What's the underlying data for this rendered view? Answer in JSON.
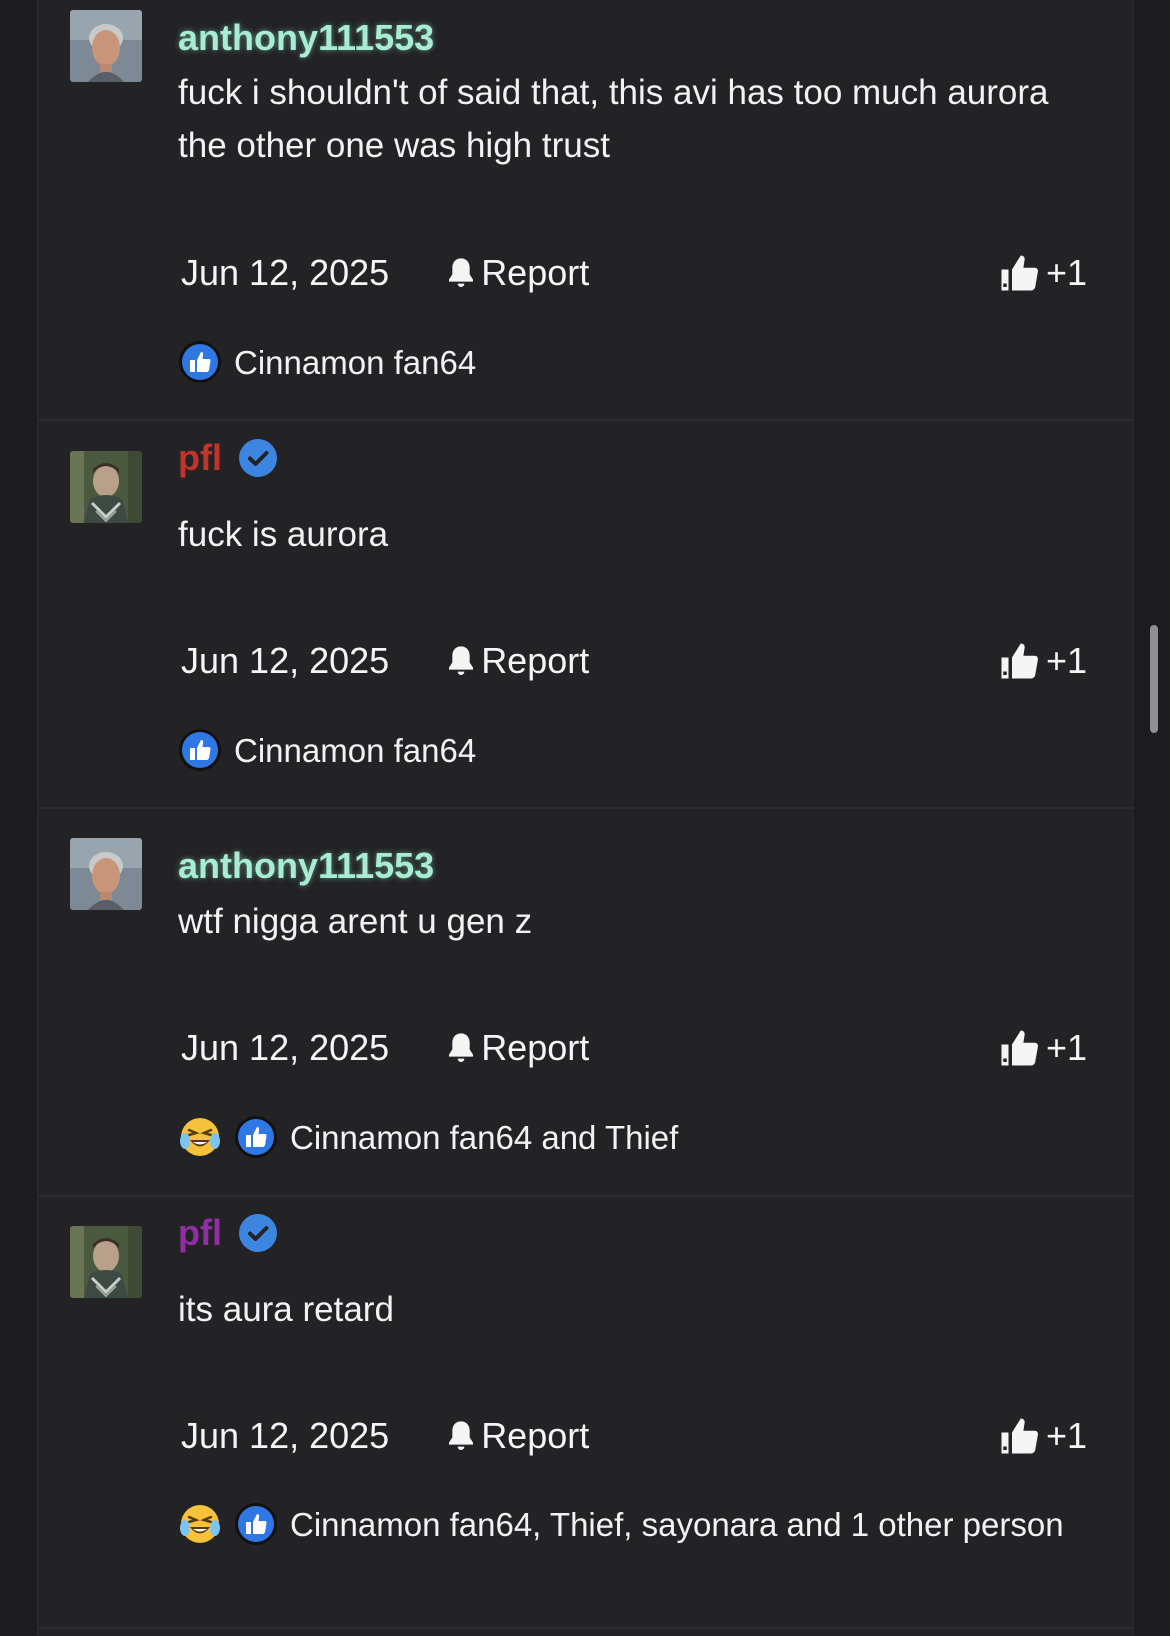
{
  "posts": [
    {
      "username": "anthony111553",
      "name_color": "#a8ecd4",
      "verified": false,
      "message": "fuck i shouldn't of said that, this avi has too much aurora the other one was high trust",
      "date": "Jun 12, 2025",
      "report_label": "Report",
      "like_count": "+1",
      "reactors": "Cinnamon fan64",
      "reaction_icons": [
        "thumbs-up"
      ]
    },
    {
      "username": "pfl",
      "name_color": "#c0342b",
      "verified": true,
      "message": "fuck is aurora",
      "date": "Jun 12, 2025",
      "report_label": "Report",
      "like_count": "+1",
      "reactors": "Cinnamon fan64",
      "reaction_icons": [
        "thumbs-up"
      ]
    },
    {
      "username": "anthony111553",
      "name_color": "#a8ecd4",
      "verified": false,
      "message": "wtf nigga arent u gen z",
      "date": "Jun 12, 2025",
      "report_label": "Report",
      "like_count": "+1",
      "reactors": "Cinnamon fan64 and Thief",
      "reaction_icons": [
        "laughing-crying",
        "thumbs-up"
      ]
    },
    {
      "username": "pfl",
      "name_color": "#8e2fa3",
      "verified": true,
      "message": "its aura retard",
      "date": "Jun 12, 2025",
      "report_label": "Report",
      "like_count": "+1",
      "reactors": "Cinnamon fan64, Thief, sayonara and 1 other person",
      "reaction_icons": [
        "laughing-crying",
        "thumbs-up"
      ]
    }
  ],
  "colors": {
    "background": "#1c1c1e",
    "panel": "#232325",
    "divider": "#2c2c2e",
    "verified_badge": "#3d86e0",
    "thumbs_reaction": "#2f78e4"
  }
}
